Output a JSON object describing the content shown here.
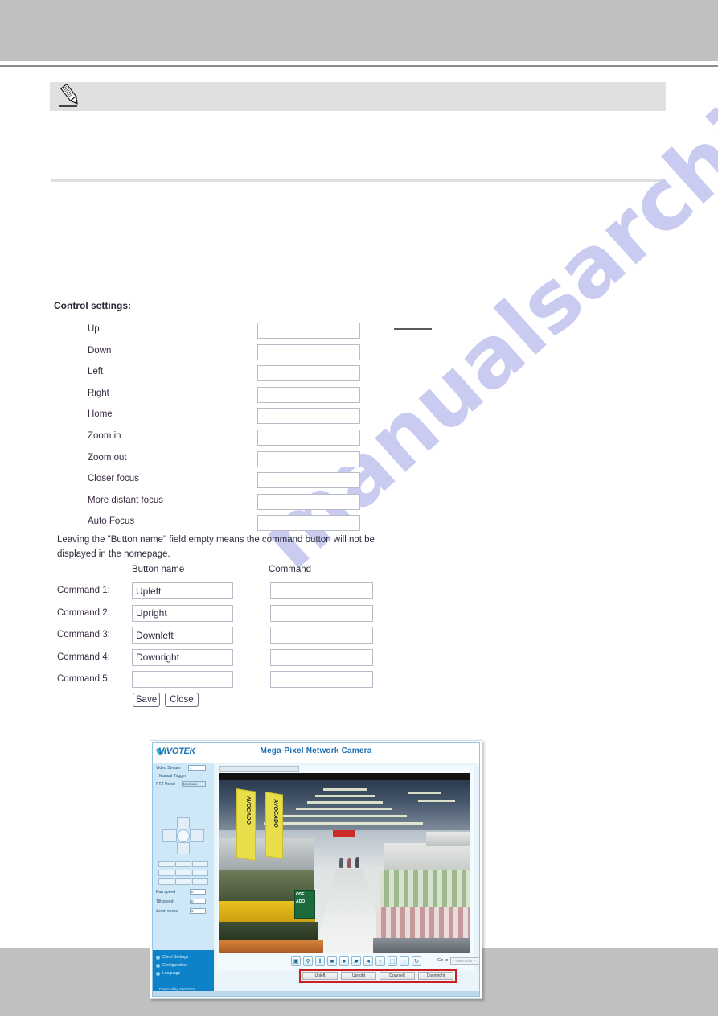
{
  "page": {
    "header_band_text": "",
    "footer_band_text": ""
  },
  "note": {
    "icon": "pencil-note-icon",
    "text": ""
  },
  "control_settings": {
    "title": "Control settings:",
    "rows": [
      {
        "label": "Up",
        "value": "",
        "placeholder": ""
      },
      {
        "label": "Down",
        "value": "",
        "placeholder": ""
      },
      {
        "label": "Left",
        "value": "",
        "placeholder": ""
      },
      {
        "label": "Right",
        "value": "",
        "placeholder": ""
      },
      {
        "label": "Home",
        "value": "",
        "placeholder": ""
      },
      {
        "label": "Zoom in",
        "value": "",
        "placeholder": ""
      },
      {
        "label": "Zoom out",
        "value": "",
        "placeholder": ""
      },
      {
        "label": "Closer focus",
        "value": "",
        "placeholder": ""
      },
      {
        "label": "More distant focus",
        "value": "",
        "placeholder": ""
      },
      {
        "label": "Auto Focus",
        "value": "",
        "placeholder": ""
      }
    ]
  },
  "help_text": "Leaving the \"Button name\" field empty means the command button will not be displayed in the homepage.",
  "commands": {
    "col_button_name": "Button name",
    "col_command": "Command",
    "rows": [
      {
        "label": "Command 1:",
        "button_name": "Upleft",
        "command": ""
      },
      {
        "label": "Command 2:",
        "button_name": "Upright",
        "command": ""
      },
      {
        "label": "Command 3:",
        "button_name": "Downleft",
        "command": ""
      },
      {
        "label": "Command 4:",
        "button_name": "Downright",
        "command": ""
      },
      {
        "label": "Command 5:",
        "button_name": "",
        "command": ""
      }
    ]
  },
  "actions": {
    "save_label": "Save",
    "close_label": "Close"
  },
  "camera_screenshot": {
    "brand": "VIVOTEK",
    "title": "Mega-Pixel Network Camera",
    "sidebar": {
      "video_stream_label": "Video Stream",
      "video_stream_value": "1",
      "manual_trigger_label": "Manual Trigger",
      "ptz_panel_label": "PTZ Panel",
      "ptz_panel_value": "Mechani",
      "pan_speed_label": "Pan speed",
      "pan_speed_value": "0",
      "tilt_speed_label": "Tilt speed",
      "tilt_speed_value": "0",
      "zoom_speed_label": "Zoom speed",
      "zoom_speed_value": "0",
      "links": [
        {
          "label": "Client Settings",
          "icon": "gear-icon"
        },
        {
          "label": "Configuration",
          "icon": "wrench-icon"
        },
        {
          "label": "Language",
          "icon": "globe-icon"
        }
      ],
      "powered_by": "Powered by VIVOTEK"
    },
    "video": {
      "banner_text_1": "AVOCADO",
      "banner_text_2": "AVOCADO",
      "sign_line_1": "OSE",
      "sign_line_2": "ADO"
    },
    "player_toolbar": {
      "buttons": [
        {
          "icon": "snapshot-icon",
          "glyph": "▣"
        },
        {
          "icon": "zoom-icon",
          "glyph": "⚲"
        },
        {
          "icon": "pause-icon",
          "glyph": "‖"
        },
        {
          "icon": "stop-icon",
          "glyph": "■"
        },
        {
          "icon": "record-icon",
          "glyph": "●"
        },
        {
          "icon": "folder-icon",
          "glyph": "▰"
        },
        {
          "icon": "volume-icon",
          "glyph": "◂"
        },
        {
          "icon": "microphone-icon",
          "glyph": "♀"
        },
        {
          "icon": "fullscreen-icon",
          "glyph": "⬚"
        },
        {
          "icon": "talk-icon",
          "glyph": "↑"
        },
        {
          "icon": "refresh-icon",
          "glyph": "↻"
        }
      ],
      "goto_label": "Go to",
      "goto_value": "-- select this --"
    },
    "custom_buttons": [
      {
        "label": "Upleft"
      },
      {
        "label": "Upright"
      },
      {
        "label": "Downleft"
      },
      {
        "label": "Downright"
      }
    ]
  },
  "watermark": {
    "text": "manualsarchive.com",
    "color": "#c9cbf0"
  },
  "colors": {
    "band_grey": "#c0c0c0",
    "note_grey": "#e0e0e0",
    "divider_grey": "#dedede",
    "field_border": "#b8bcc8",
    "label_text": "#3a2b42",
    "vivotek_blue": "#1b75bb",
    "highlight_red": "#cc1f1f"
  }
}
